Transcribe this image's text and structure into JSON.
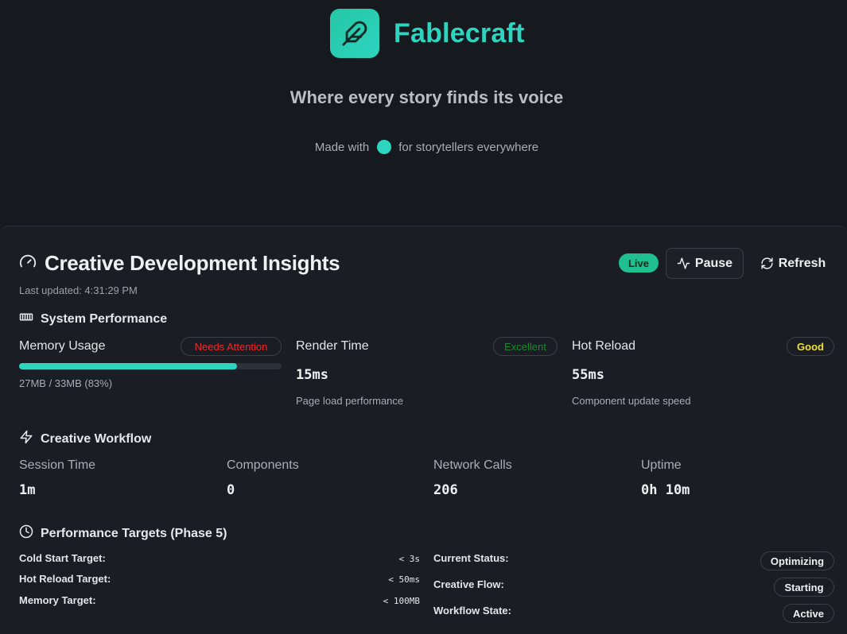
{
  "hero": {
    "brand_name": "Fablecraft",
    "logo_icon": "feather-icon",
    "tagline": "Where every story finds its voice",
    "made_with_prefix": "Made with",
    "made_with_suffix": "for storytellers everywhere"
  },
  "panel": {
    "title": "Creative Development Insights",
    "last_updated": "Last updated: 4:31:29 PM",
    "live_label": "Live",
    "pause_label": "Pause",
    "refresh_label": "Refresh"
  },
  "system_performance": {
    "heading": "System Performance",
    "memory": {
      "label": "Memory Usage",
      "badge": "Needs Attention",
      "detail": "27MB / 33MB (83%)",
      "fill_percent": 83
    },
    "render": {
      "label": "Render Time",
      "badge": "Excellent",
      "value": "15ms",
      "caption": "Page load performance"
    },
    "hot_reload": {
      "label": "Hot Reload",
      "badge": "Good",
      "value": "55ms",
      "caption": "Component update speed"
    }
  },
  "workflow": {
    "heading": "Creative Workflow",
    "items": [
      {
        "label": "Session Time",
        "value": "1m"
      },
      {
        "label": "Components",
        "value": "0"
      },
      {
        "label": "Network Calls",
        "value": "206"
      },
      {
        "label": "Uptime",
        "value": "0h 10m"
      }
    ]
  },
  "targets": {
    "heading": "Performance Targets (Phase 5)",
    "rows": [
      {
        "label": "Cold Start Target:",
        "value": "< 3s"
      },
      {
        "label": "Hot Reload Target:",
        "value": "< 50ms"
      },
      {
        "label": "Memory Target:",
        "value": "< 100MB"
      }
    ],
    "status": [
      {
        "label": "Current Status:",
        "value": "Optimizing"
      },
      {
        "label": "Creative Flow:",
        "value": "Starting"
      },
      {
        "label": "Workflow State:",
        "value": "Active"
      }
    ]
  },
  "colors": {
    "accent": "#2dd4bf",
    "background": "#16191e",
    "attention": "#ef2b2b",
    "excellent": "#1a8a2e",
    "good": "#f1e22c"
  }
}
